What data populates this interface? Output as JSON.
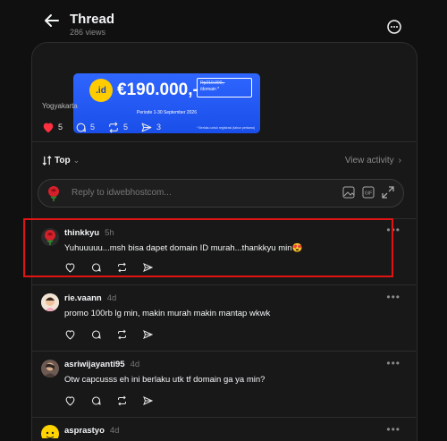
{
  "header": {
    "title": "Thread",
    "views": "286 views"
  },
  "banner": {
    "logo": ".id",
    "price": "€190.000,-",
    "box_old": "Rp210.000,-",
    "box_unit": "/domain *",
    "period": "Periode 1-30 September 2026",
    "note": "* Berlaku untuk registrasi (tahun pertama)"
  },
  "post": {
    "location": "Yogyakarta",
    "likes": "5",
    "comments": "5",
    "reposts": "5",
    "shares": "3"
  },
  "sort": {
    "label": "Top",
    "view_activity": "View activity"
  },
  "reply": {
    "placeholder": "Reply to idwebhostcom..."
  },
  "comments": [
    {
      "user": "thinkkyu",
      "time": "5h",
      "text": "Yuhuuuuu...msh bisa dapet domain ID murah...thankkyu min😍"
    },
    {
      "user": "rie.vaann",
      "time": "4d",
      "text": "promo 100rb lg min, makin murah makin mantap wkwk"
    },
    {
      "user": "asriwijayanti95",
      "time": "4d",
      "text": "Otw capcusss eh ini berlaku utk tf domain ga ya min?"
    },
    {
      "user": "asprastyo",
      "time": "4d",
      "text": ""
    }
  ],
  "colors": {
    "background": "#101010",
    "card": "#181818",
    "like": "#ff3040",
    "highlight": "#e11414",
    "banner": "#1a4ee8"
  }
}
